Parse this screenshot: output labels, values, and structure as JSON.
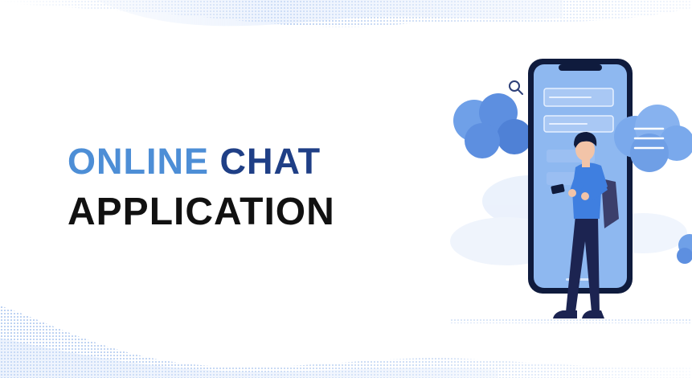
{
  "headline": {
    "word_1": "ONLINE",
    "word_2": "CHAT",
    "line_2": "APPLICATION"
  },
  "colors": {
    "accent_light": "#4d8ed6",
    "accent_dark": "#1f3f86",
    "text_primary": "#111111",
    "phone_frame": "#0f1b3d",
    "phone_screen": "#8eb8f0",
    "cloud": "#6fa0e8",
    "shirt": "#3f7fe0",
    "pants": "#1c2451"
  },
  "icons": {
    "search": "search-icon",
    "message_lines": "message-lines-icon"
  }
}
